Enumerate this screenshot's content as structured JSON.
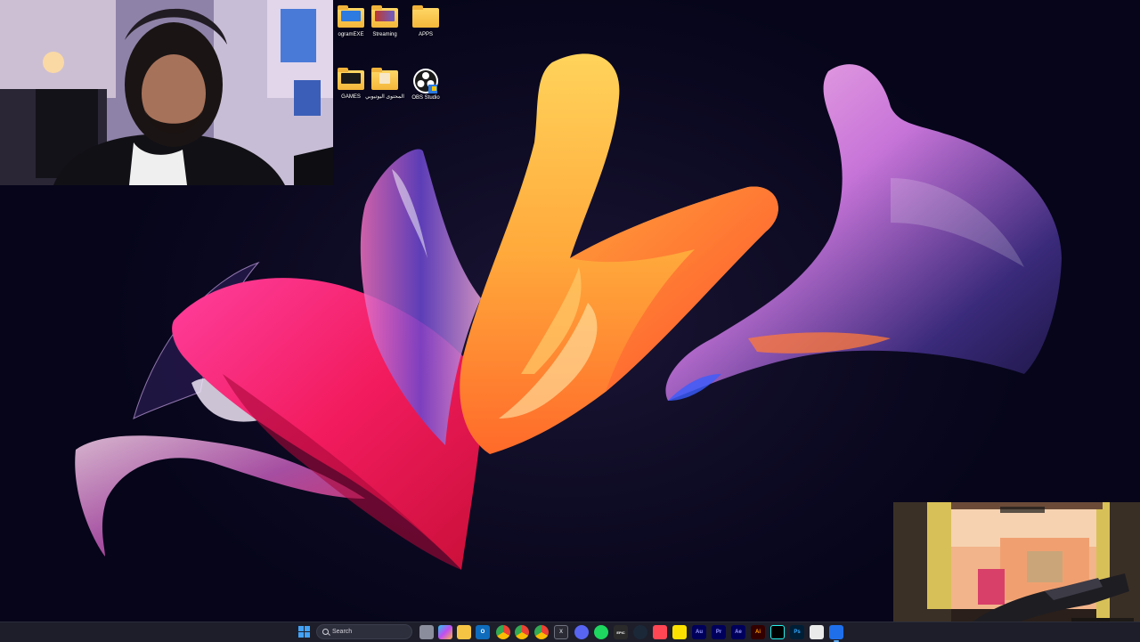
{
  "desktop": {
    "icons": [
      {
        "label": "ogramEXE",
        "icon": "folder-with-preview-icon"
      },
      {
        "label": "Streaming",
        "icon": "folder-with-preview-icon"
      },
      {
        "label": "APPS",
        "icon": "folder-icon"
      },
      {
        "label": "GAMES",
        "icon": "folder-with-preview-icon"
      },
      {
        "label": "المحتوى اليوتيوبي",
        "icon": "folder-with-preview-icon"
      },
      {
        "label": "OBS Studio",
        "icon": "obs-studio-icon"
      }
    ]
  },
  "taskbar": {
    "search_label": "Search",
    "apps": [
      {
        "name": "file-explorer",
        "text": ""
      },
      {
        "name": "copilot",
        "text": ""
      },
      {
        "name": "files-app",
        "text": ""
      },
      {
        "name": "outlook",
        "text": "O"
      },
      {
        "name": "chrome",
        "text": ""
      },
      {
        "name": "chrome-canary",
        "text": ""
      },
      {
        "name": "chrome-profile",
        "text": ""
      },
      {
        "name": "xbox",
        "text": "X"
      },
      {
        "name": "discord",
        "text": ""
      },
      {
        "name": "spotify",
        "text": ""
      },
      {
        "name": "epic-games",
        "text": "EPIC"
      },
      {
        "name": "steam",
        "text": ""
      },
      {
        "name": "valorant",
        "text": ""
      },
      {
        "name": "sticky-notes",
        "text": ""
      },
      {
        "name": "audition",
        "text": "Au"
      },
      {
        "name": "premiere-pro",
        "text": "Pr"
      },
      {
        "name": "after-effects",
        "text": "Ae"
      },
      {
        "name": "illustrator",
        "text": "Ai"
      },
      {
        "name": "tiktok",
        "text": ""
      },
      {
        "name": "photoshop",
        "text": "Ps"
      },
      {
        "name": "capcut",
        "text": ""
      },
      {
        "name": "vs-code",
        "text": ""
      }
    ]
  },
  "colors": {
    "taskbar_bg": "#1d1e2a",
    "accent": "#43a2f5",
    "folder": "#f4b73a"
  }
}
